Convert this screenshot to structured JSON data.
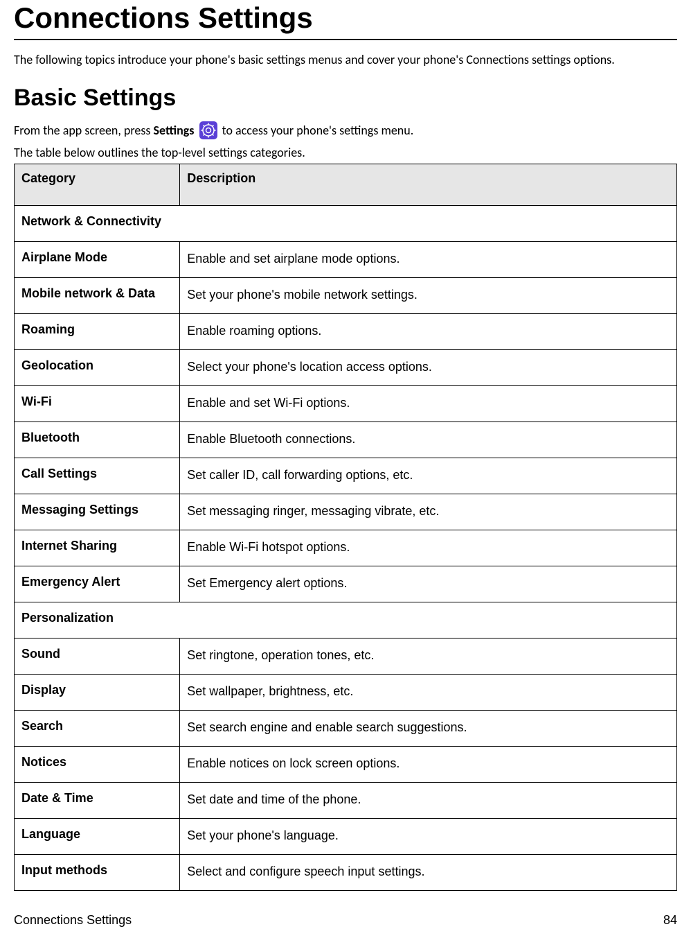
{
  "page_title": "Connections Settings",
  "intro_text": "The following topics introduce your phone's basic settings menus and cover your phone's Connections settings options.",
  "section_heading": "Basic Settings",
  "instruction_prefix": "From the app screen, press ",
  "instruction_bold": "Settings",
  "instruction_suffix": "  to access your phone's settings menu.",
  "table_caption": "The table below outlines the top-level settings categories.",
  "table": {
    "header_category": "Category",
    "header_description": "Description",
    "sections": [
      {
        "section_label": "Network & Connectivity",
        "rows": [
          {
            "category": "Airplane Mode",
            "description": "Enable and set airplane mode options."
          },
          {
            "category": "Mobile network & Data",
            "description": "Set your phone's mobile network settings."
          },
          {
            "category": "Roaming",
            "description": "Enable roaming options."
          },
          {
            "category": "Geolocation",
            "description": "Select your phone's location access options."
          },
          {
            "category": "Wi-Fi",
            "description": "Enable and set Wi-Fi options."
          },
          {
            "category": "Bluetooth",
            "description": "Enable Bluetooth connections."
          },
          {
            "category": "Call Settings",
            "description": "Set caller ID, call forwarding options, etc."
          },
          {
            "category": "Messaging Settings",
            "description": "Set messaging ringer, messaging vibrate, etc."
          },
          {
            "category": "Internet Sharing",
            "description": "Enable Wi-Fi hotspot options."
          },
          {
            "category": "Emergency Alert",
            "description": "Set Emergency alert options."
          }
        ]
      },
      {
        "section_label": "Personalization",
        "rows": [
          {
            "category": "Sound",
            "description": "Set ringtone, operation tones, etc."
          },
          {
            "category": "Display",
            "description": "Set wallpaper, brightness, etc."
          },
          {
            "category": "Search",
            "description": "Set search engine and enable search suggestions."
          },
          {
            "category": "Notices",
            "description": "Enable notices on lock screen options."
          },
          {
            "category": "Date & Time",
            "description": "Set date and time of the phone."
          },
          {
            "category": "Language",
            "description": "Set your phone's language."
          },
          {
            "category": "Input methods",
            "description": "Select and configure speech input settings."
          }
        ]
      }
    ]
  },
  "footer_left": "Connections Settings",
  "footer_right": "84"
}
